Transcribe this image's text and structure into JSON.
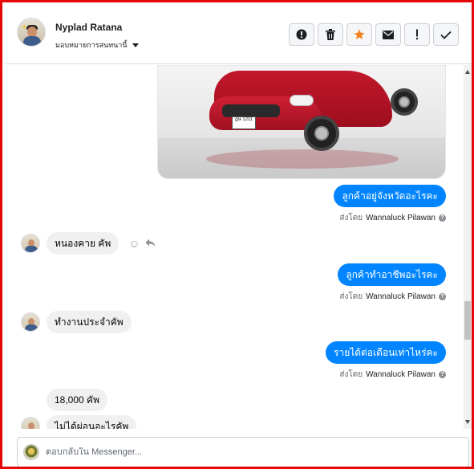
{
  "header": {
    "contact_name": "Nyplad Ratana",
    "assign_label": "มอบหมายการสนทนานี้",
    "toolbar": [
      {
        "icon": "alert-circle-icon"
      },
      {
        "icon": "trash-icon"
      },
      {
        "icon": "star-icon"
      },
      {
        "icon": "mail-icon"
      },
      {
        "icon": "exclamation-icon"
      },
      {
        "icon": "check-icon"
      }
    ]
  },
  "image_message": {
    "plate_text": "ฎษ 1211"
  },
  "messages": {
    "out_1": {
      "text": "ลูกค้าอยู่จังหวัดอะไรคะ",
      "sent_by_prefix": "ส่งโดย",
      "sender": "Wannaluck Pilawan"
    },
    "in_1": {
      "text": "หนองคาย คัพ"
    },
    "out_2": {
      "text": "ลูกค้าทำอาชีพอะไรคะ",
      "sent_by_prefix": "ส่งโดย",
      "sender": "Wannaluck Pilawan"
    },
    "in_2": {
      "text": "ทำงานประจำคัพ"
    },
    "out_3": {
      "text": "รายได้ต่อเดือนเท่าไหร่คะ",
      "sent_by_prefix": "ส่งโดย",
      "sender": "Wannaluck Pilawan"
    },
    "in_3": {
      "text": "18,000 คัพ"
    },
    "in_4": {
      "text": "ไม่ได้ผ่อนอะไรคัพ"
    }
  },
  "composer": {
    "placeholder": "ตอบกลับใน Messenger..."
  },
  "colors": {
    "frame_border": "#e4080a",
    "outgoing_bubble": "#0084ff",
    "incoming_bubble": "#f0f0f0",
    "star": "#f5821f"
  }
}
